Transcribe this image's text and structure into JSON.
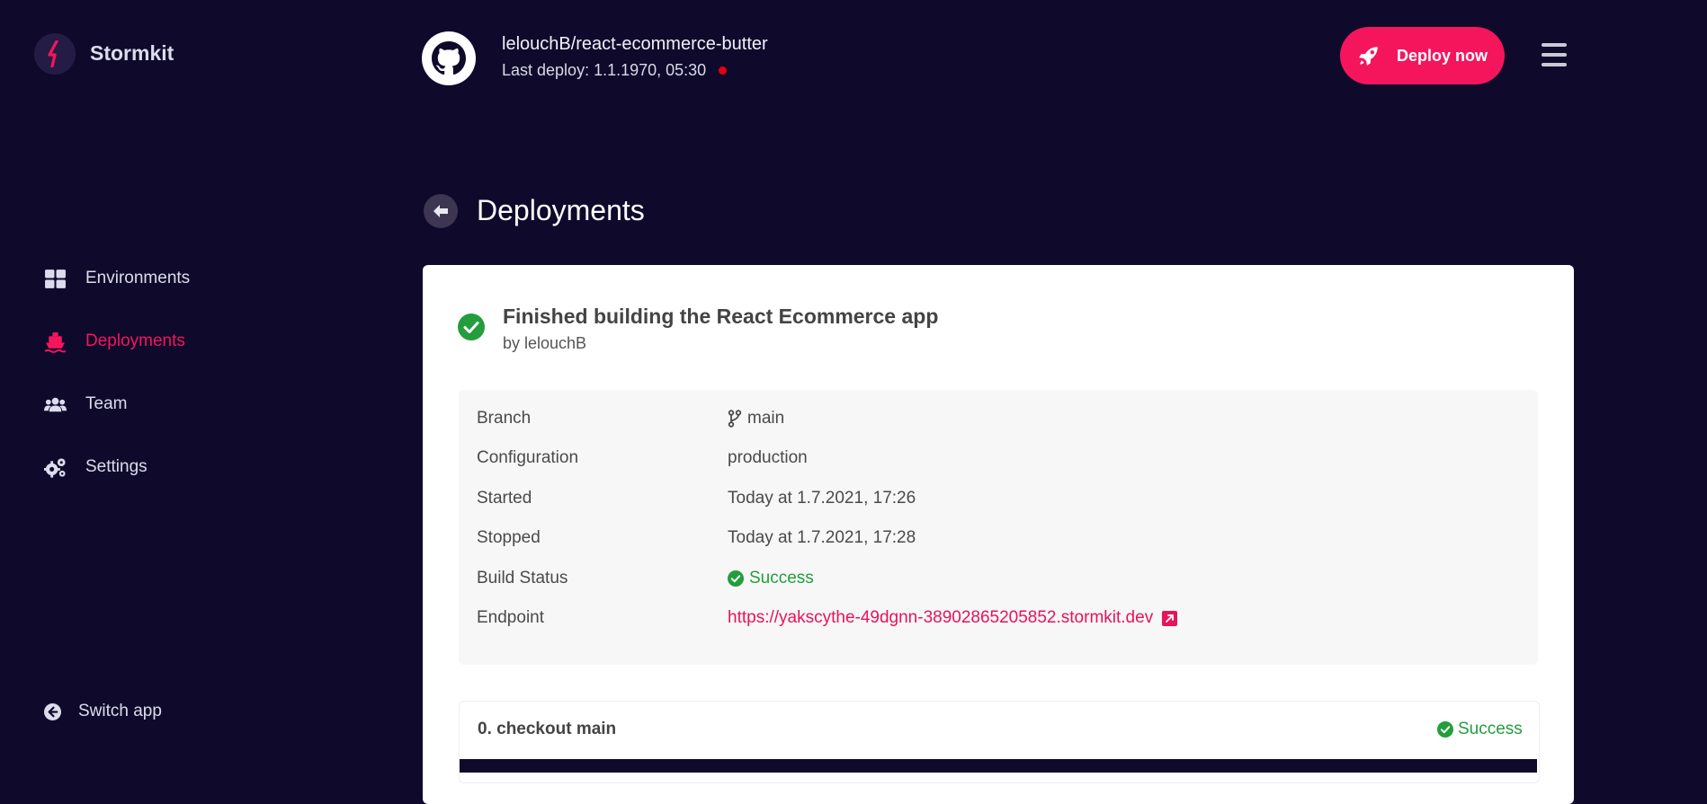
{
  "sidebar": {
    "brand": "Stormkit",
    "items": [
      {
        "label": "Environments",
        "icon": "grid-icon",
        "active": false
      },
      {
        "label": "Deployments",
        "icon": "ship-icon",
        "active": true
      },
      {
        "label": "Team",
        "icon": "users-icon",
        "active": false
      },
      {
        "label": "Settings",
        "icon": "gears-icon",
        "active": false
      }
    ],
    "switch_app": "Switch app"
  },
  "header": {
    "repo": "lelouchB/react-ecommerce-butter",
    "last_deploy": "Last deploy: 1.1.1970, 05:30",
    "deploy_button": "Deploy now",
    "status_color": "#e5000f"
  },
  "page": {
    "title": "Deployments"
  },
  "deployment": {
    "title": "Finished building the React Ecommerce app",
    "author": "by lelouchB",
    "details": [
      {
        "label": "Branch",
        "value": "main"
      },
      {
        "label": "Configuration",
        "value": "production"
      },
      {
        "label": "Started",
        "value": "Today at 1.7.2021, 17:26"
      },
      {
        "label": "Stopped",
        "value": "Today at 1.7.2021, 17:28"
      },
      {
        "label": "Build Status",
        "value": "Success"
      },
      {
        "label": "Endpoint",
        "value": "https://yakscythe-49dgnn-38902865205852.stormkit.dev"
      }
    ],
    "steps": [
      {
        "label": "0. checkout main",
        "status": "Success"
      }
    ]
  },
  "colors": {
    "accent": "#f5155d",
    "success": "#249d3d",
    "background": "#0f0a2c"
  }
}
